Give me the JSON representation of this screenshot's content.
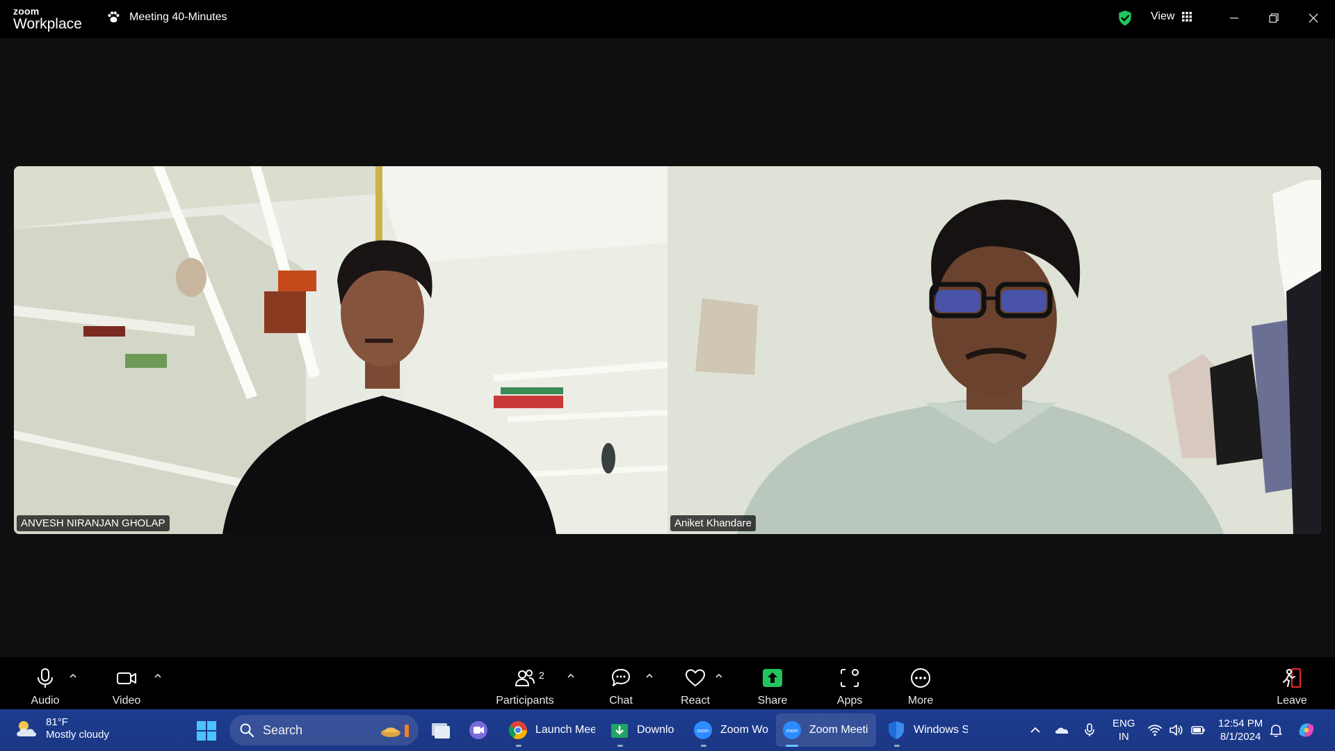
{
  "app": {
    "logo_small": "zoom",
    "logo_big": "Workplace",
    "meeting_title": "Meeting 40-Minutes",
    "view_label": "View"
  },
  "participants": [
    {
      "name": "ANVESH NIRANJAN GHOLAP"
    },
    {
      "name": "Aniket Khandare"
    }
  ],
  "toolbar": {
    "audio": "Audio",
    "video": "Video",
    "participants": "Participants",
    "participants_count": "2",
    "chat": "Chat",
    "react": "React",
    "share": "Share",
    "apps": "Apps",
    "more": "More",
    "leave": "Leave"
  },
  "taskbar": {
    "weather_temp": "81°F",
    "weather_desc": "Mostly cloudy",
    "search_label": "Search",
    "apps": [
      {
        "label": "Launch Meet"
      },
      {
        "label": "Downlo"
      },
      {
        "label": "Zoom Wo"
      },
      {
        "label": "Zoom Meeti"
      },
      {
        "label": "Windows S"
      }
    ],
    "lang_line1": "ENG",
    "lang_line2": "IN",
    "time": "12:54 PM",
    "date": "8/1/2024"
  },
  "colors": {
    "share_green": "#22c55e",
    "shield_green": "#22c55e",
    "leave_red": "#e02828",
    "taskbar_blue": "#1d3c8f"
  },
  "icons": [
    "paw-icon",
    "shield-check-icon",
    "grid-icon",
    "minimize-icon",
    "restore-icon",
    "close-icon",
    "microphone-icon",
    "camera-icon",
    "people-icon",
    "chat-bubble-icon",
    "heart-icon",
    "share-arrow-icon",
    "apps-icon",
    "more-dots-icon",
    "leave-icon",
    "weather-cloud-icon",
    "windows-start-icon",
    "search-icon",
    "file-explorer-icon",
    "teams-icon",
    "chrome-icon",
    "download-icon",
    "zoom-icon",
    "defender-icon",
    "chevron-up-icon",
    "onedrive-icon",
    "mic-tray-icon",
    "wifi-icon",
    "volume-icon",
    "battery-icon",
    "bell-icon",
    "copilot-icon"
  ]
}
